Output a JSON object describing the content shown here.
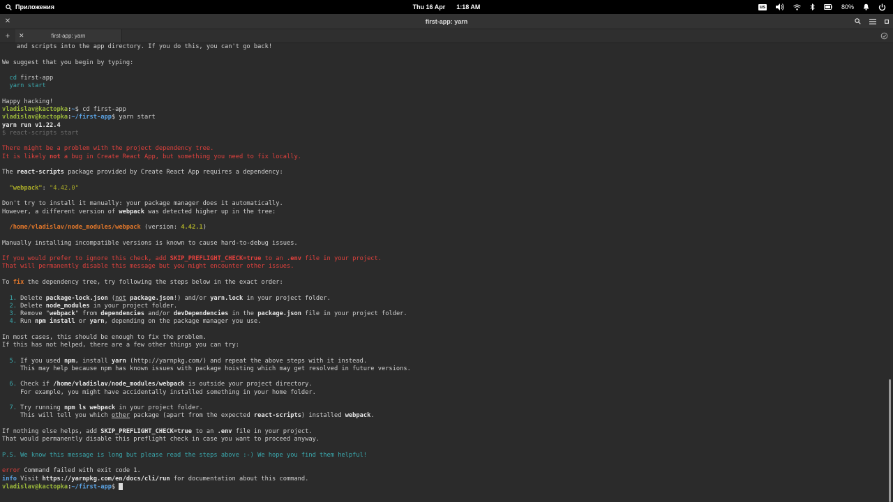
{
  "system_bar": {
    "apps_label": "Приложения",
    "date": "Thu 16 Apr",
    "time": "1:18 AM",
    "keyboard_layout": "us",
    "battery": "80%"
  },
  "window": {
    "title": "first-app: yarn"
  },
  "tabs": [
    {
      "label": "first-app: yarn"
    }
  ],
  "colors": {
    "prompt_user": "#9ab73b",
    "prompt_path": "#5ba4e6",
    "error_red": "#e2413d",
    "highlight_orange": "#e2772b",
    "cyan": "#3aa9ae",
    "olive": "#a9aa28"
  },
  "terminal": {
    "lines": [
      [
        {
          "t": "    and scripts into the app directory. If you do this, you can't go back!"
        }
      ],
      [],
      [
        {
          "t": "We suggest that you begin by typing:"
        }
      ],
      [],
      [
        {
          "t": "  "
        },
        {
          "t": "cd",
          "s": "cyan"
        },
        {
          "t": " first-app"
        }
      ],
      [
        {
          "t": "  "
        },
        {
          "t": "yarn start",
          "s": "cyan"
        }
      ],
      [],
      [
        {
          "t": "Happy hacking!"
        }
      ],
      [
        {
          "t": "vladislav@kactopka",
          "s": "green"
        },
        {
          "t": ":",
          "s": "bold"
        },
        {
          "t": "~",
          "s": "blue"
        },
        {
          "t": "$ cd first-app"
        }
      ],
      [
        {
          "t": "vladislav@kactopka",
          "s": "green"
        },
        {
          "t": ":",
          "s": "bold"
        },
        {
          "t": "~/first-app",
          "s": "blue"
        },
        {
          "t": "$ yarn start"
        }
      ],
      [
        {
          "t": "yarn run v1.22.4",
          "s": "bold"
        }
      ],
      [
        {
          "t": "$ react-scripts start",
          "s": "gray"
        }
      ],
      [],
      [
        {
          "t": "There might be a problem with the project dependency tree.",
          "s": "red"
        }
      ],
      [
        {
          "t": "It is likely ",
          "s": "red"
        },
        {
          "t": "not",
          "s": "redb"
        },
        {
          "t": " a bug in Create React App, but something you need to fix locally.",
          "s": "red"
        }
      ],
      [],
      [
        {
          "t": "The "
        },
        {
          "t": "react-scripts",
          "s": "bold"
        },
        {
          "t": " package provided by Create React App requires a dependency:"
        }
      ],
      [],
      [
        {
          "t": "  "
        },
        {
          "t": "\"webpack\"",
          "s": "oliveb"
        },
        {
          "t": ": "
        },
        {
          "t": "\"4.42.0\"",
          "s": "olive"
        }
      ],
      [],
      [
        {
          "t": "Don't try to install it manually: your package manager does it automatically."
        }
      ],
      [
        {
          "t": "However, a different version of "
        },
        {
          "t": "webpack",
          "s": "bold"
        },
        {
          "t": " was detected higher up in the tree:"
        }
      ],
      [],
      [
        {
          "t": "  "
        },
        {
          "t": "/home/vladislav/node_modules/webpack",
          "s": "orange"
        },
        {
          "t": " (version: "
        },
        {
          "t": "4.42.1",
          "s": "oliveb"
        },
        {
          "t": ")"
        }
      ],
      [],
      [
        {
          "t": "Manually installing incompatible versions is known to cause hard-to-debug issues."
        }
      ],
      [],
      [
        {
          "t": "If you would prefer to ignore this check, add ",
          "s": "red"
        },
        {
          "t": "SKIP_PREFLIGHT_CHECK=true",
          "s": "redb"
        },
        {
          "t": " to an ",
          "s": "red"
        },
        {
          "t": ".env",
          "s": "redb"
        },
        {
          "t": " file in your project.",
          "s": "red"
        }
      ],
      [
        {
          "t": "That will permanently disable this message but you might encounter other issues.",
          "s": "red"
        }
      ],
      [],
      [
        {
          "t": "To "
        },
        {
          "t": "fix",
          "s": "orange"
        },
        {
          "t": " the dependency tree, try following the steps below in the exact order:"
        }
      ],
      [],
      [
        {
          "t": "  "
        },
        {
          "t": "1.",
          "s": "cyan"
        },
        {
          "t": " Delete "
        },
        {
          "t": "package-lock.json",
          "s": "bold"
        },
        {
          "t": " ("
        },
        {
          "t": "not",
          "s": "u"
        },
        {
          "t": " "
        },
        {
          "t": "package.json",
          "s": "bold"
        },
        {
          "t": "!) and/or "
        },
        {
          "t": "yarn.lock",
          "s": "bold"
        },
        {
          "t": " in your project folder."
        }
      ],
      [
        {
          "t": "  "
        },
        {
          "t": "2.",
          "s": "cyan"
        },
        {
          "t": " Delete "
        },
        {
          "t": "node_modules",
          "s": "bold"
        },
        {
          "t": " in your project folder."
        }
      ],
      [
        {
          "t": "  "
        },
        {
          "t": "3.",
          "s": "cyan"
        },
        {
          "t": " Remove \""
        },
        {
          "t": "webpack",
          "s": "bold"
        },
        {
          "t": "\" from "
        },
        {
          "t": "dependencies",
          "s": "bold"
        },
        {
          "t": " and/or "
        },
        {
          "t": "devDependencies",
          "s": "bold"
        },
        {
          "t": " in the "
        },
        {
          "t": "package.json",
          "s": "bold"
        },
        {
          "t": " file in your project folder."
        }
      ],
      [
        {
          "t": "  "
        },
        {
          "t": "4.",
          "s": "cyan"
        },
        {
          "t": " Run "
        },
        {
          "t": "npm install",
          "s": "bold"
        },
        {
          "t": " or "
        },
        {
          "t": "yarn",
          "s": "bold"
        },
        {
          "t": ", depending on the package manager you use."
        }
      ],
      [],
      [
        {
          "t": "In most cases, this should be enough to fix the problem."
        }
      ],
      [
        {
          "t": "If this has not helped, there are a few other things you can try:"
        }
      ],
      [],
      [
        {
          "t": "  "
        },
        {
          "t": "5.",
          "s": "cyan"
        },
        {
          "t": " If you used "
        },
        {
          "t": "npm",
          "s": "bold"
        },
        {
          "t": ", install "
        },
        {
          "t": "yarn",
          "s": "bold"
        },
        {
          "t": " (http://yarnpkg.com/) and repeat the above steps with it instead."
        }
      ],
      [
        {
          "t": "     This may help because npm has known issues with package hoisting which may get resolved in future versions."
        }
      ],
      [],
      [
        {
          "t": "  "
        },
        {
          "t": "6.",
          "s": "cyan"
        },
        {
          "t": " Check if "
        },
        {
          "t": "/home/vladislav/node_modules/webpack",
          "s": "bold"
        },
        {
          "t": " is outside your project directory."
        }
      ],
      [
        {
          "t": "     For example, you might have accidentally installed something in your home folder."
        }
      ],
      [],
      [
        {
          "t": "  "
        },
        {
          "t": "7.",
          "s": "cyan"
        },
        {
          "t": " Try running "
        },
        {
          "t": "npm ls webpack",
          "s": "bold"
        },
        {
          "t": " in your project folder."
        }
      ],
      [
        {
          "t": "     This will tell you which "
        },
        {
          "t": "other",
          "s": "u"
        },
        {
          "t": " package (apart from the expected "
        },
        {
          "t": "react-scripts",
          "s": "bold"
        },
        {
          "t": ") installed "
        },
        {
          "t": "webpack",
          "s": "bold"
        },
        {
          "t": "."
        }
      ],
      [],
      [
        {
          "t": "If nothing else helps, add "
        },
        {
          "t": "SKIP_PREFLIGHT_CHECK=true",
          "s": "bold"
        },
        {
          "t": " to an "
        },
        {
          "t": ".env",
          "s": "bold"
        },
        {
          "t": " file in your project."
        }
      ],
      [
        {
          "t": "That would permanently disable this preflight check in case you want to proceed anyway."
        }
      ],
      [],
      [
        {
          "t": "P.S. We know this message is long but please read the steps above :-) We hope you find them helpful!",
          "s": "cyan"
        }
      ],
      [],
      [
        {
          "t": "error",
          "s": "red"
        },
        {
          "t": " Command failed with exit code 1."
        }
      ],
      [
        {
          "t": "info",
          "s": "blue"
        },
        {
          "t": " Visit "
        },
        {
          "t": "https://yarnpkg.com/en/docs/cli/run",
          "s": "bold"
        },
        {
          "t": " for documentation about this command."
        }
      ],
      [
        {
          "t": "vladislav@kactopka",
          "s": "green"
        },
        {
          "t": ":",
          "s": "bold"
        },
        {
          "t": "~/first-app",
          "s": "blue"
        },
        {
          "t": "$ "
        }
      ]
    ]
  }
}
